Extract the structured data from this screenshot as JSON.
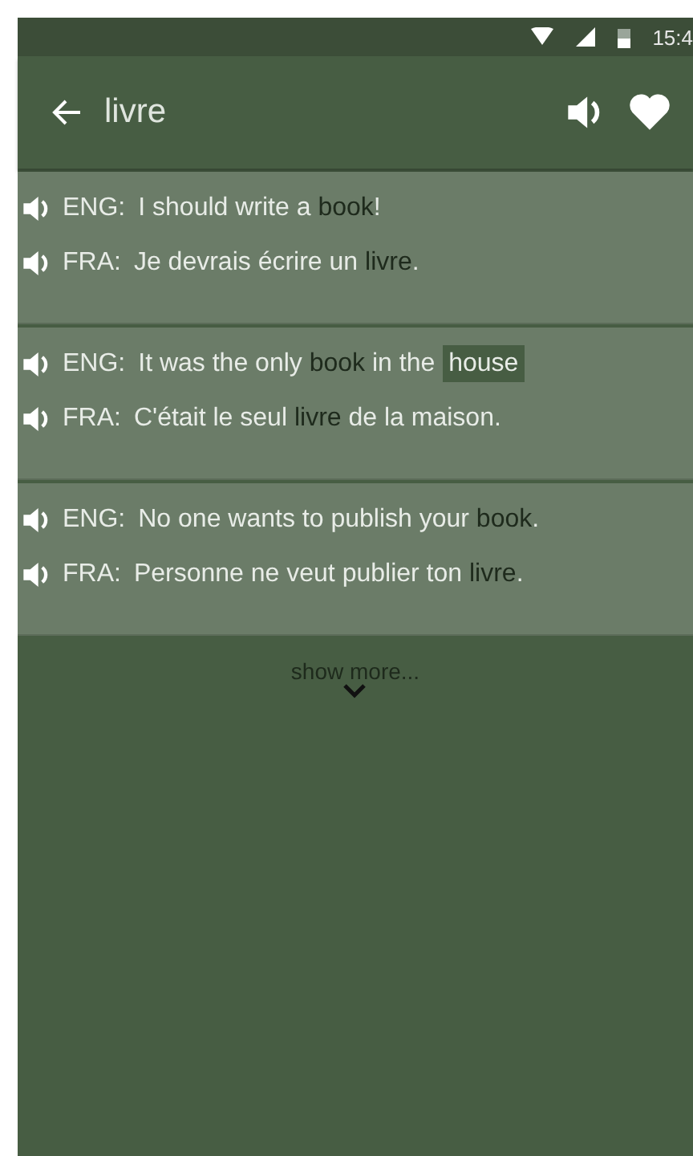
{
  "status_bar": {
    "time": "15:4"
  },
  "app_bar": {
    "query": "livre"
  },
  "examples": [
    {
      "lines": [
        {
          "lang": "ENG:",
          "segments": [
            {
              "kind": "plain",
              "text": "I should write a "
            },
            {
              "kind": "match",
              "text": "book"
            },
            {
              "kind": "plain",
              "text": "!"
            }
          ]
        },
        {
          "lang": "FRA:",
          "segments": [
            {
              "kind": "plain",
              "text": "Je devrais écrire un "
            },
            {
              "kind": "match",
              "text": "livre"
            },
            {
              "kind": "plain",
              "text": "."
            }
          ]
        }
      ]
    },
    {
      "lines": [
        {
          "lang": "ENG:",
          "segments": [
            {
              "kind": "plain",
              "text": "It was the only "
            },
            {
              "kind": "match",
              "text": "book"
            },
            {
              "kind": "plain",
              "text": " in the "
            },
            {
              "kind": "mark",
              "text": "house"
            }
          ]
        },
        {
          "lang": "FRA:",
          "segments": [
            {
              "kind": "plain",
              "text": "C'était le seul "
            },
            {
              "kind": "match",
              "text": "livre"
            },
            {
              "kind": "plain",
              "text": " de la maison."
            }
          ]
        }
      ]
    },
    {
      "lines": [
        {
          "lang": "ENG:",
          "segments": [
            {
              "kind": "plain",
              "text": "No one wants to publish your "
            },
            {
              "kind": "match",
              "text": "book"
            },
            {
              "kind": "plain",
              "text": "."
            }
          ]
        },
        {
          "lang": "FRA:",
          "segments": [
            {
              "kind": "plain",
              "text": "Personne ne veut publier ton "
            },
            {
              "kind": "match",
              "text": "livre"
            },
            {
              "kind": "plain",
              "text": "."
            }
          ]
        }
      ]
    }
  ],
  "show_more": "show more..."
}
